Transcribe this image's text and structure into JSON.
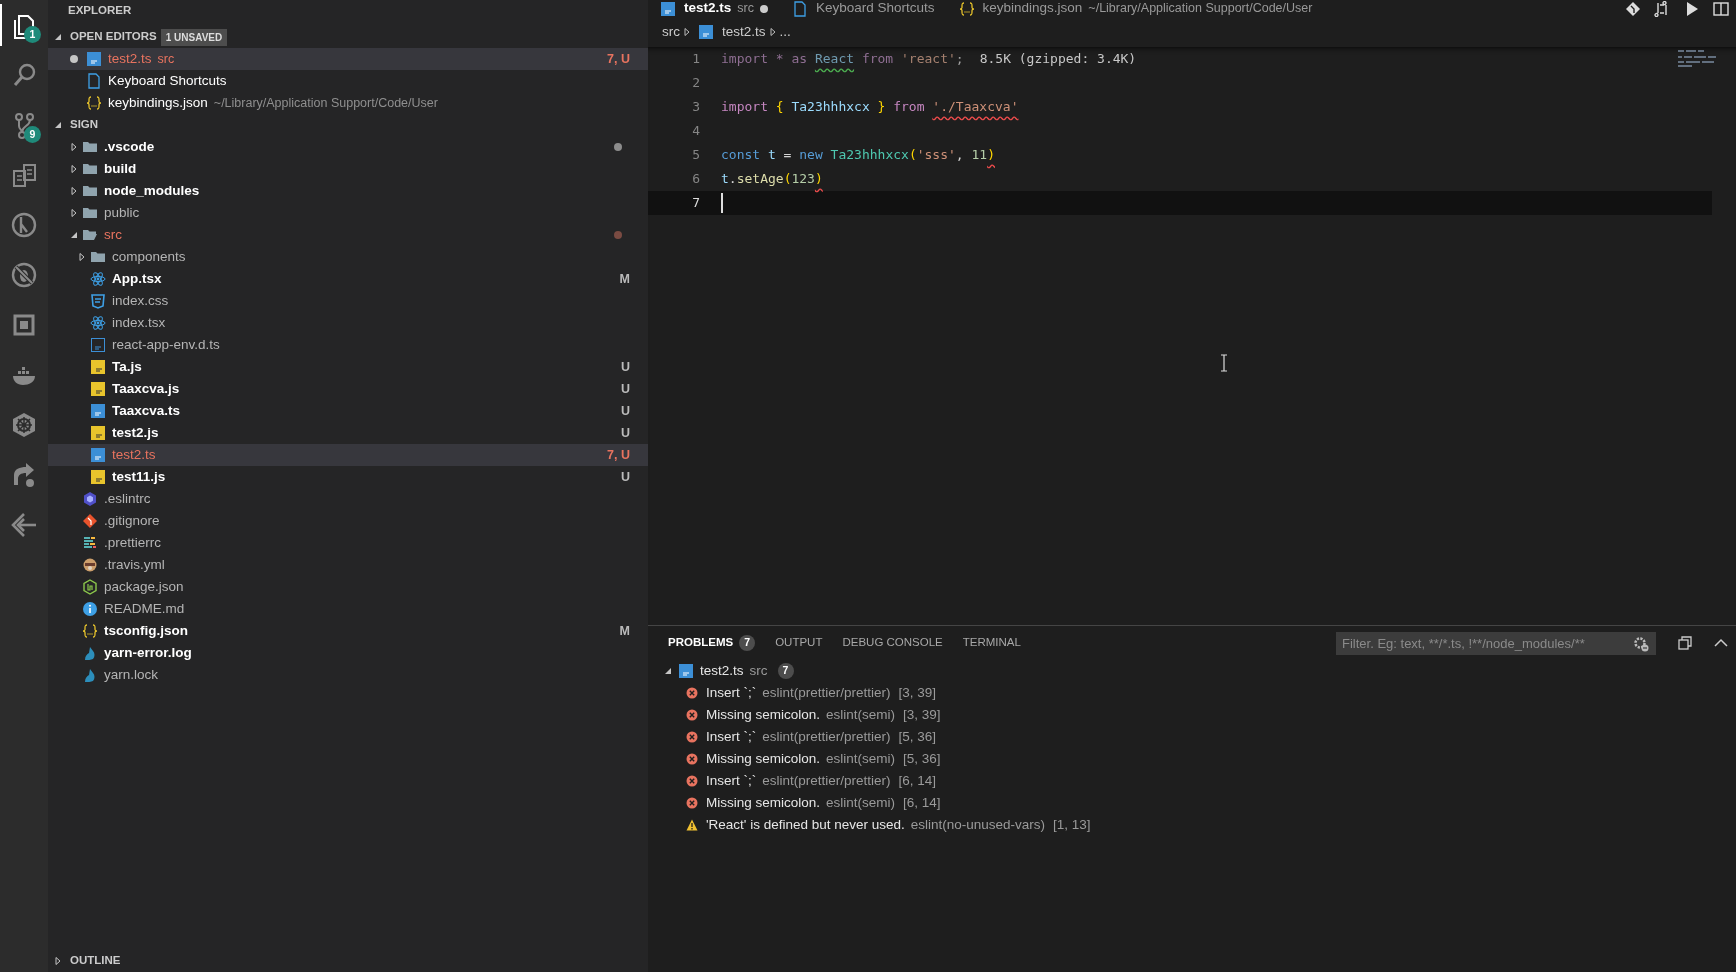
{
  "activity_bar": {
    "items": [
      {
        "selected": true,
        "badge": "1"
      },
      {
        "selected": false
      },
      {
        "selected": false,
        "badge": "9"
      },
      {
        "selected": false
      },
      {
        "selected": false
      },
      {
        "selected": false
      },
      {
        "selected": false
      },
      {
        "selected": false
      },
      {
        "selected": false
      },
      {
        "selected": false
      },
      {
        "selected": false
      }
    ]
  },
  "sidebar": {
    "title": "EXPLORER",
    "open_editors": {
      "title": "OPEN EDITORS",
      "badge": "1 UNSAVED",
      "expanded": true,
      "items": [
        {
          "kind": "ts",
          "name": "test2.ts",
          "description": "src",
          "status": "7, U",
          "dirty": true,
          "error": true,
          "selected": true
        },
        {
          "kind": "file",
          "name": "Keyboard Shortcuts",
          "dirty": false,
          "error": false,
          "selected": false
        },
        {
          "kind": "json",
          "name": "keybindings.json",
          "description": "~/Library/Application Support/Code/User",
          "dirty": false,
          "error": false,
          "selected": false
        }
      ]
    },
    "folder": {
      "title": "SIGN",
      "expanded": true,
      "items": [
        {
          "kind": "folder",
          "name": ".vscode",
          "expanded": false,
          "bright": true,
          "error": false,
          "selected": false,
          "color": "#8c8c8c"
        },
        {
          "kind": "folder",
          "name": "build",
          "expanded": false,
          "bright": true,
          "error": false,
          "selected": false
        },
        {
          "kind": "folder",
          "name": "node_modules",
          "expanded": false,
          "bright": true,
          "error": false,
          "selected": false
        },
        {
          "kind": "folder",
          "name": "public",
          "expanded": false,
          "bright": false,
          "error": false,
          "selected": false
        },
        {
          "kind": "folder",
          "name": "src",
          "expanded": true,
          "bright": false,
          "error": true,
          "selected": false,
          "color": "#7a4b42",
          "children": [
            {
              "kind": "folder",
              "name": "components",
              "expanded": false,
              "bright": false,
              "error": false,
              "selected": false
            },
            {
              "kind": "react",
              "name": "App.tsx",
              "status": "M",
              "bright": true,
              "error": false,
              "selected": false
            },
            {
              "kind": "css",
              "name": "index.css",
              "bright": false,
              "error": false,
              "selected": false
            },
            {
              "kind": "react",
              "name": "index.tsx",
              "bright": false,
              "error": false,
              "selected": false
            },
            {
              "kind": "ts-outline",
              "name": "react-app-env.d.ts",
              "bright": false,
              "error": false,
              "selected": false
            },
            {
              "kind": "js",
              "name": "Ta.js",
              "status": "U",
              "bright": true,
              "error": false,
              "selected": false
            },
            {
              "kind": "js",
              "name": "Taaxcva.js",
              "status": "U",
              "bright": true,
              "error": false,
              "selected": false
            },
            {
              "kind": "ts",
              "name": "Taaxcva.ts",
              "status": "U",
              "bright": true,
              "error": false,
              "selected": false
            },
            {
              "kind": "js",
              "name": "test2.js",
              "status": "U",
              "bright": true,
              "error": false,
              "selected": false
            },
            {
              "kind": "ts",
              "name": "test2.ts",
              "status": "7, U",
              "bright": true,
              "error": true,
              "selected": true
            },
            {
              "kind": "js",
              "name": "test11.js",
              "status": "U",
              "bright": true,
              "error": false,
              "selected": false
            }
          ]
        },
        {
          "kind": "eslint",
          "name": ".eslintrc",
          "bright": false,
          "error": false,
          "selected": false
        },
        {
          "kind": "git",
          "name": ".gitignore",
          "bright": false,
          "error": false,
          "selected": false
        },
        {
          "kind": "prettier",
          "name": ".prettierrc",
          "bright": false,
          "error": false,
          "selected": false
        },
        {
          "kind": "travis",
          "name": ".travis.yml",
          "bright": false,
          "error": false,
          "selected": false
        },
        {
          "kind": "npm",
          "name": "package.json",
          "bright": false,
          "error": false,
          "selected": false
        },
        {
          "kind": "info",
          "name": "README.md",
          "bright": false,
          "error": false,
          "selected": false
        },
        {
          "kind": "json",
          "name": "tsconfig.json",
          "status": "M",
          "bright": true,
          "error": false,
          "selected": false
        },
        {
          "kind": "yarn",
          "name": "yarn-error.log",
          "bright": true,
          "error": false,
          "selected": false
        },
        {
          "kind": "yarn",
          "name": "yarn.lock",
          "bright": false,
          "error": false,
          "selected": false
        }
      ]
    },
    "outline": {
      "title": "OUTLINE",
      "expanded": false
    }
  },
  "editor_tabs": [
    {
      "kind": "ts",
      "label": "test2.ts",
      "description": "src",
      "selected": true,
      "dirty": true
    },
    {
      "kind": "file",
      "label": "Keyboard Shortcuts",
      "selected": false,
      "dirty": false
    },
    {
      "kind": "json",
      "label": "keybindings.json",
      "description": "~/Library/Application Support/Code/User",
      "selected": false,
      "dirty": false
    }
  ],
  "breadcrumb": [
    {
      "kind": "folder",
      "label": "src"
    },
    {
      "kind": "ts",
      "label": "test2.ts"
    },
    {
      "kind": "more",
      "label": "..."
    }
  ],
  "code_lines": [
    {
      "number": "1",
      "current": false,
      "tokens": [
        {
          "kind": "kw-dim",
          "text": "import * as "
        },
        {
          "kind": "var-dim",
          "text": "React",
          "warning_squiggle": true
        },
        {
          "kind": "kw-dim",
          "text": " from "
        },
        {
          "kind": "str-dim",
          "text": "'react'"
        },
        {
          "kind": "plain-dim",
          "text": ";"
        }
      ],
      "hint": "8.5K (gzipped: 3.4K)"
    },
    {
      "number": "2",
      "current": false
    },
    {
      "number": "3",
      "current": false,
      "tokens": [
        {
          "kind": "kw",
          "text": "import "
        },
        {
          "kind": "brace",
          "text": "{ "
        },
        {
          "kind": "var",
          "text": "Ta23hhhxcx"
        },
        {
          "kind": "brace",
          "text": " }"
        },
        {
          "kind": "kw",
          "text": " from "
        },
        {
          "kind": "str",
          "text": "'./Taaxcva'",
          "error_squiggle": true
        }
      ]
    },
    {
      "number": "4",
      "current": false
    },
    {
      "number": "5",
      "current": false,
      "tokens": [
        {
          "kind": "storage",
          "text": "const "
        },
        {
          "kind": "var",
          "text": "t"
        },
        {
          "kind": "plain",
          "text": " = "
        },
        {
          "kind": "storage",
          "text": "new "
        },
        {
          "kind": "type",
          "text": "Ta23hhhxcx"
        },
        {
          "kind": "brace",
          "text": "("
        },
        {
          "kind": "str",
          "text": "'sss'"
        },
        {
          "kind": "plain",
          "text": ", "
        },
        {
          "kind": "num",
          "text": "11"
        },
        {
          "kind": "brace",
          "text": ")",
          "error_squiggle": true
        }
      ]
    },
    {
      "number": "6",
      "current": false,
      "tokens": [
        {
          "kind": "var",
          "text": "t"
        },
        {
          "kind": "plain",
          "text": "."
        },
        {
          "kind": "fn",
          "text": "setAge"
        },
        {
          "kind": "brace",
          "text": "("
        },
        {
          "kind": "num",
          "text": "123"
        },
        {
          "kind": "brace",
          "text": ")",
          "error_squiggle": true
        }
      ]
    },
    {
      "number": "7",
      "current": true
    }
  ],
  "panel": {
    "tabs": [
      {
        "label": "PROBLEMS",
        "badge": "7",
        "selected": true
      },
      {
        "label": "OUTPUT",
        "selected": false
      },
      {
        "label": "DEBUG CONSOLE",
        "selected": false
      },
      {
        "label": "TERMINAL",
        "selected": false
      }
    ],
    "filter": {
      "placeholder": "Filter. Eg: text, **/*.ts, !**/node_modules/**"
    },
    "problems": {
      "file": "test2.ts",
      "description": "src",
      "count": "7",
      "expanded": true,
      "items": [
        {
          "kind": "error",
          "message": "Insert `;`",
          "source": "eslint(prettier/prettier)",
          "location": "[3, 39]"
        },
        {
          "kind": "error",
          "message": "Missing semicolon.",
          "source": "eslint(semi)",
          "location": "[3, 39]"
        },
        {
          "kind": "error",
          "message": "Insert `;`",
          "source": "eslint(prettier/prettier)",
          "location": "[5, 36]"
        },
        {
          "kind": "error",
          "message": "Missing semicolon.",
          "source": "eslint(semi)",
          "location": "[5, 36]"
        },
        {
          "kind": "error",
          "message": "Insert `;`",
          "source": "eslint(prettier/prettier)",
          "location": "[6, 14]"
        },
        {
          "kind": "error",
          "message": "Missing semicolon.",
          "source": "eslint(semi)",
          "location": "[6, 14]"
        },
        {
          "kind": "warning",
          "message": "'React' is defined but never used.",
          "source": "eslint(no-unused-vars)",
          "location": "[1, 13]"
        }
      ]
    }
  }
}
